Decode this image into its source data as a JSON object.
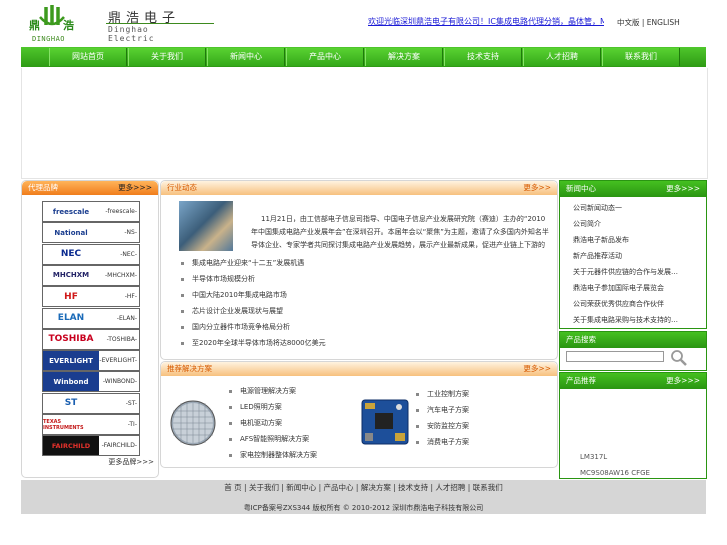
{
  "header": {
    "logo_cn_left": "鼎",
    "logo_cn_right": "浩",
    "logo_en": "DINGHAO",
    "company_cn": "鼎浩电子",
    "company_en": "Dinghao Electric",
    "top_note": "欢迎光临深圳鼎浩电子有限公司！IC集成电路代理分销，晶体管，MOS管，三极管，二极管，稳压管",
    "lang_cn": "中文版",
    "lang_sep": " | ",
    "lang_en": "ENGLISH"
  },
  "nav": {
    "items": [
      "网站首页",
      "关于我们",
      "新闻中心",
      "产品中心",
      "解决方案",
      "技术支持",
      "人才招聘",
      "联系我们"
    ]
  },
  "brands": {
    "title": "代理品牌",
    "more": "更多>>>",
    "bottom_more": "更多品牌>>>",
    "items": [
      {
        "logo": "freescale",
        "text": "-freescale-",
        "color": "#1a3d8f"
      },
      {
        "logo": "National",
        "text": "-NS-",
        "color": "#1a3d8f"
      },
      {
        "logo": "NEC",
        "text": "-NEC-",
        "color": "#0a2a8f"
      },
      {
        "logo": "MHCHXM",
        "text": "-MHCHXM-",
        "color": "#222266"
      },
      {
        "logo": "HF",
        "text": "-HF-",
        "color": "#d01818"
      },
      {
        "logo": "ELAN",
        "text": "-ELAN-",
        "color": "#1a6ab8"
      },
      {
        "logo": "TOSHIBA",
        "text": "-TOSHIBA-",
        "color": "#c8001e"
      },
      {
        "logo": "EVERLIGHT",
        "text": "-EVERLIGHT-",
        "color": "#1a3d8f"
      },
      {
        "logo": "Winbond",
        "text": "-WINBOND-",
        "color": "#1a3d8f"
      },
      {
        "logo": "ST",
        "text": "-ST-",
        "color": "#1a5fb0"
      },
      {
        "logo": "TEXAS INSTRUMENTS",
        "text": "-TI-",
        "color": "#c41a1a"
      },
      {
        "logo": "FAIRCHILD",
        "text": "-FAIRCHILD-",
        "color": "#c8001e"
      }
    ]
  },
  "news": {
    "title": "行业动态",
    "more": "更多>>",
    "summary": "11月21日，由工信部电子信息司指导、中国电子信息产业发展研究院（赛迪）主办的“2010年中国集成电路产业发展年会”在深圳召开。本届年会以“聚焦”为主题，邀请了众多国内外知名半导体企业、专家学者共同探讨集成电路产业发展趋势，展示产业最新成果，促进产业链上下游的交流合作。2010年，中国集成电路市场规模将持续增长…",
    "items": [
      "集成电路产业迎来“十二五”发展机遇",
      "半导体市场规模分析",
      "中国大陆2010年集成电路市场",
      "芯片设计企业发展现状与展望",
      "国内分立器件市场竞争格局分析",
      "至2020年全球半导体市场将达8000亿美元"
    ]
  },
  "solutions": {
    "title": "推荐解决方案",
    "more": "更多>>",
    "left_items": [
      "电源管理解决方案",
      "LED照明方案",
      "电机驱动方案",
      "AFS智能照明解决方案",
      "家电控制器整体解决方案"
    ],
    "right_items": [
      "工业控制方案",
      "汽车电子方案",
      "安防监控方案",
      "消费电子方案"
    ]
  },
  "right_news": {
    "title": "新闻中心",
    "more": "更多>>>",
    "items": [
      "公司新闻动态一",
      "公司简介",
      "鼎浩电子新品发布",
      "新产品推荐活动",
      "关于元器件供应链的合作与发展…",
      "鼎浩电子参加国际电子展览会",
      "公司荣获优秀供应商合作伙伴",
      "关于集成电路采购与技术支持的…"
    ]
  },
  "search": {
    "title": "产品搜索",
    "placeholder": ""
  },
  "products": {
    "title": "产品推荐",
    "more": "更多>>>",
    "items": [
      "LM317L",
      "MC9S08AW16 CFGE"
    ]
  },
  "footer": {
    "links": "首 页 | 关于我们 | 新闻中心 | 产品中心 | 解决方案 | 技术支持 | 人才招聘 | 联系我们",
    "copyright": "粤ICP备案号ZXS344 版权所有 © 2010-2012 深圳市鼎浩电子科技有限公司"
  },
  "colors": {
    "nav_green": "#34a819",
    "orange_header": "#f07d1c",
    "link_blue": "#1a1ad6"
  }
}
